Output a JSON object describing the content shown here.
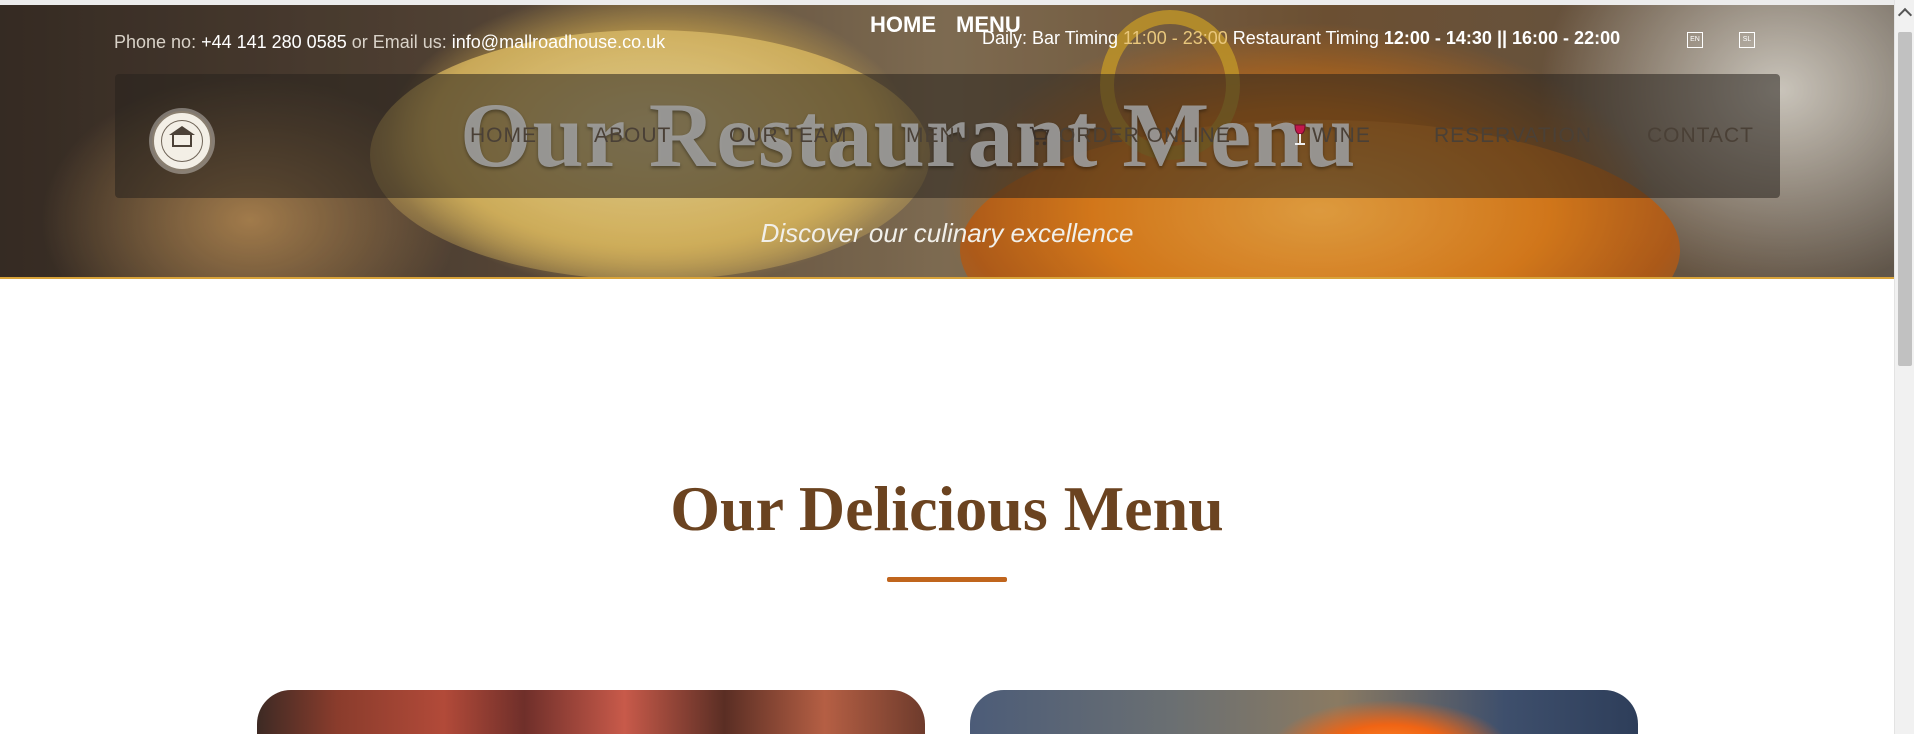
{
  "topnav": {
    "home_label": "HOME",
    "menu_label": "MENU"
  },
  "topbar": {
    "phone_prefix": "Phone no: ",
    "phone": "+44 141 280 0585",
    "or_text": " or ",
    "email_prefix": "Email us: ",
    "email": "info@mallroadhouse.co.uk",
    "bar_timing_label": "Daily: Bar Timing ",
    "bar_timing": "11:00 - 23:00",
    "restaurant_timing_label": " Restaurant Timing ",
    "restaurant_timing": "12:00 - 14:30 || 16:00 - 22:00"
  },
  "nav": {
    "items": [
      {
        "label": "HOME"
      },
      {
        "label": "ABOUT"
      },
      {
        "label": "OUR TEAM"
      },
      {
        "label": "MENU"
      },
      {
        "label": "ORDER ONLINE"
      },
      {
        "label": "WINE"
      },
      {
        "label": "RESERVATION"
      },
      {
        "label": "CONTACT"
      }
    ]
  },
  "hero": {
    "title": "Our Restaurant Menu",
    "subtitle": "Discover our culinary excellence"
  },
  "section": {
    "title": "Our Delicious Menu"
  },
  "colors": {
    "brand_brown": "#6b4320",
    "accent_orange": "#c0651d"
  },
  "icons": {
    "logo": "mallroad-house-logo",
    "cart": "shopping-cart-icon",
    "wine": "wine-glass-icon"
  }
}
